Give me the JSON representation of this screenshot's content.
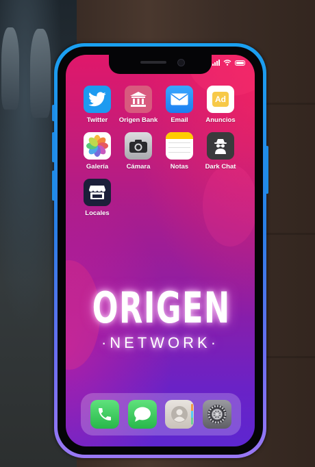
{
  "apps": [
    {
      "name": "app-twitter",
      "label": "Twitter",
      "icon": "bird-icon",
      "color": "#1d9bf0"
    },
    {
      "name": "app-origen-bank",
      "label": "Origen Bank",
      "icon": "bank-icon",
      "color": "#d85a7e"
    },
    {
      "name": "app-email",
      "label": "Email",
      "icon": "mail-icon",
      "color": "#2196f3"
    },
    {
      "name": "app-anuncios",
      "label": "Anuncios",
      "icon": "ad-icon",
      "badge_text": "Ad",
      "color": "#ffffff"
    },
    {
      "name": "app-galeria",
      "label": "Galería",
      "icon": "photos-icon",
      "color": "#ffffff"
    },
    {
      "name": "app-camara",
      "label": "Cámara",
      "icon": "camera-icon",
      "color": "#c9c9cc"
    },
    {
      "name": "app-notas",
      "label": "Notas",
      "icon": "notes-icon",
      "color": "#ffffff"
    },
    {
      "name": "app-dark-chat",
      "label": "Dark Chat",
      "icon": "spy-icon",
      "color": "#3a3a3c"
    },
    {
      "name": "app-locales",
      "label": "Locales",
      "icon": "store-icon",
      "color": "#1b1f3a"
    }
  ],
  "brand": {
    "title": "ORIGEN",
    "subtitle": "·NETWORK·"
  },
  "dock": [
    {
      "name": "dock-phone",
      "icon": "phone-icon",
      "color": "#34c759"
    },
    {
      "name": "dock-messages",
      "icon": "message-icon",
      "color": "#34c759"
    },
    {
      "name": "dock-contacts",
      "icon": "contacts-icon",
      "color": "#d9d4cf"
    },
    {
      "name": "dock-settings",
      "icon": "settings-icon",
      "color": "#8e8e93"
    }
  ],
  "colors": {
    "wallpaper_top": "#e0186a",
    "wallpaper_bottom": "#5d26d0",
    "frame": "#1aa0f0"
  }
}
